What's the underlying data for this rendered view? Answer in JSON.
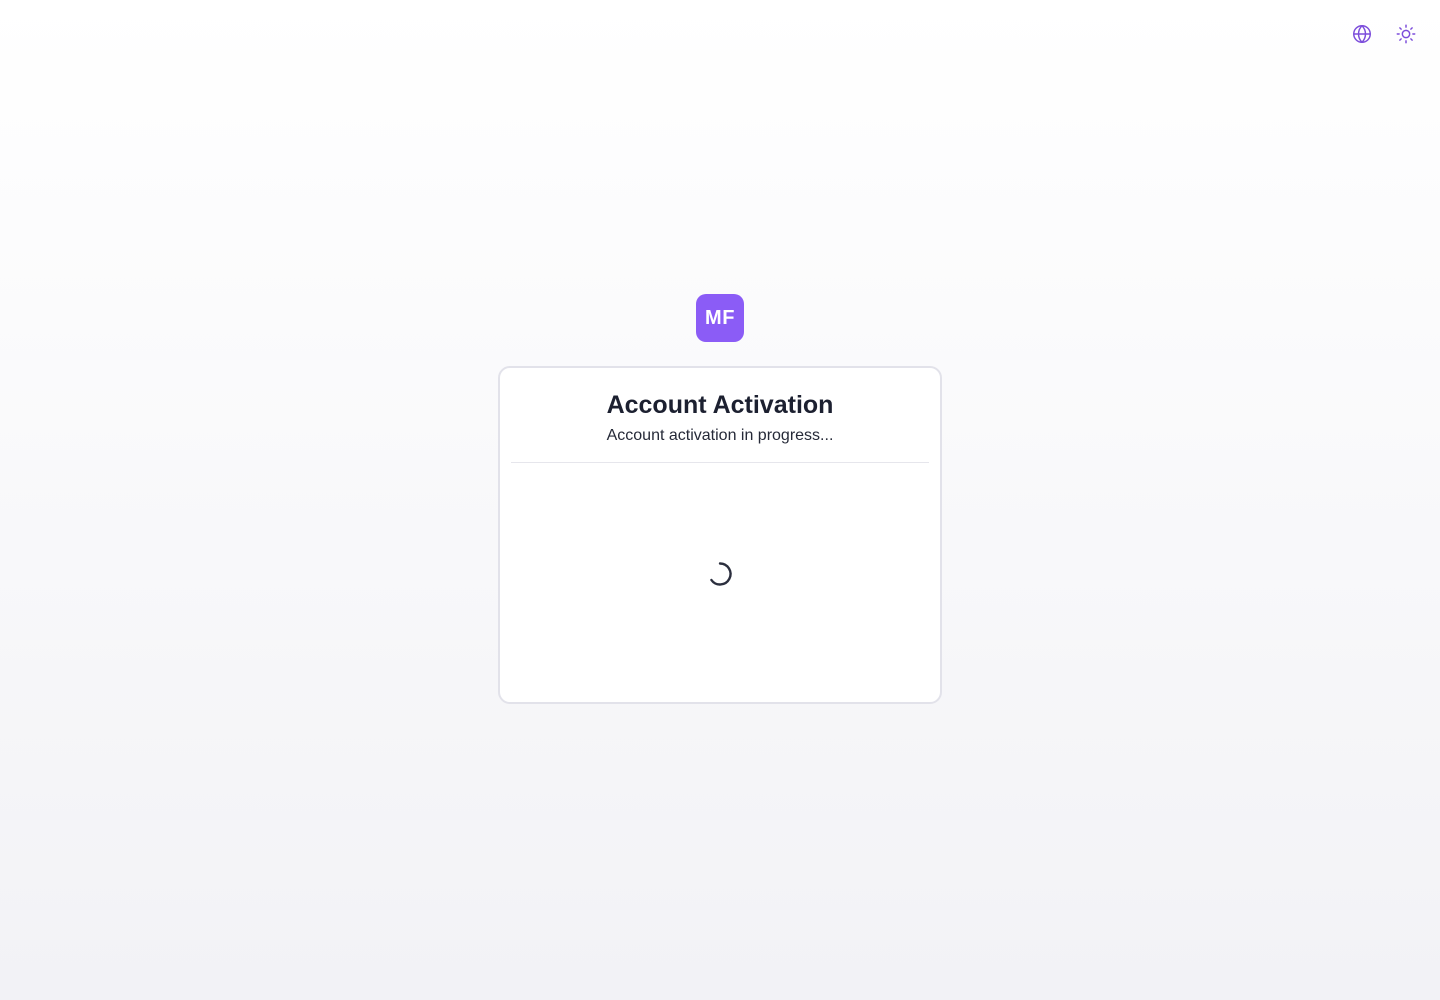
{
  "header": {
    "language_icon": "globe-icon",
    "theme_icon": "sun-icon"
  },
  "logo": {
    "text": "MF"
  },
  "card": {
    "title": "Account Activation",
    "subtitle": "Account activation in progress..."
  },
  "status": {
    "loading_icon": "spinner-icon"
  },
  "colors": {
    "accent": "#8b5cf6",
    "icon": "#7c4ddb",
    "text": "#1c2030",
    "border": "#e2e2ea"
  }
}
